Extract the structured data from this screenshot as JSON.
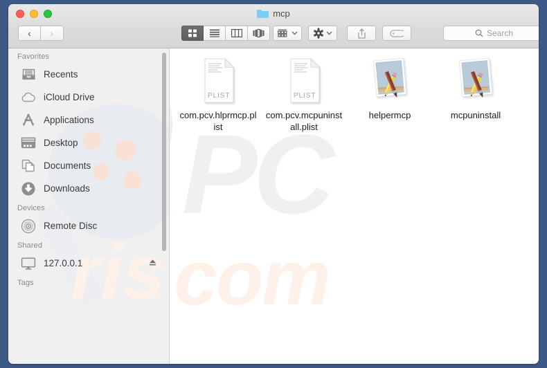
{
  "window": {
    "title": "mcp",
    "title_icon": "folder-icon",
    "traffic_lights": [
      {
        "name": "close-button",
        "color": "#ff5f57"
      },
      {
        "name": "minimize-button",
        "color": "#ffbd2e"
      },
      {
        "name": "maximize-button",
        "color": "#28c840"
      }
    ]
  },
  "toolbar": {
    "back_label": "‹",
    "forward_label": "›",
    "views": [
      {
        "name": "icon-view-button",
        "icon": "grid-icon",
        "active": true
      },
      {
        "name": "list-view-button",
        "icon": "list-icon",
        "active": false
      },
      {
        "name": "column-view-button",
        "icon": "columns-icon",
        "active": false
      },
      {
        "name": "gallery-view-button",
        "icon": "coverflow-icon",
        "active": false
      }
    ],
    "arrange_icon": "arrange-icon",
    "action_icon": "gear-icon",
    "share_icon": "share-icon",
    "tag_icon": "tag-icon",
    "chevron": "⌄"
  },
  "search": {
    "placeholder": "Search",
    "icon": "search-icon"
  },
  "sidebar": {
    "sections": [
      {
        "header": "Favorites",
        "items": [
          {
            "label": "Recents",
            "icon": "recents-icon"
          },
          {
            "label": "iCloud Drive",
            "icon": "icloud-icon"
          },
          {
            "label": "Applications",
            "icon": "applications-icon"
          },
          {
            "label": "Desktop",
            "icon": "desktop-icon"
          },
          {
            "label": "Documents",
            "icon": "documents-icon"
          },
          {
            "label": "Downloads",
            "icon": "downloads-icon"
          }
        ]
      },
      {
        "header": "Devices",
        "items": [
          {
            "label": "Remote Disc",
            "icon": "optical-disc-icon"
          }
        ]
      },
      {
        "header": "Shared",
        "items": [
          {
            "label": "127.0.0.1",
            "icon": "computer-icon",
            "eject": "⏏"
          }
        ]
      },
      {
        "header": "Tags",
        "items": []
      }
    ]
  },
  "files": [
    {
      "name": "com.pcv.hlprmcp.plist",
      "type": "plist",
      "badge": "PLIST"
    },
    {
      "name": "com.pcv.mcpuninstall.plist",
      "type": "plist",
      "badge": "PLIST"
    },
    {
      "name": "helpermcp",
      "type": "app",
      "badge": ""
    },
    {
      "name": "mcpuninstall",
      "type": "app",
      "badge": ""
    }
  ],
  "watermark": {
    "text_primary": "PC",
    "text_secondary": "risk.com",
    "color_primary": "#f0f0f0",
    "color_secondary": "#fdf1e9"
  },
  "colors": {
    "desktop": "#3d5a87",
    "titlebar": "#dcdcdc",
    "sidebar": "#f0f0f0",
    "content": "#ffffff",
    "folder_blue": "#7ecdf5"
  }
}
